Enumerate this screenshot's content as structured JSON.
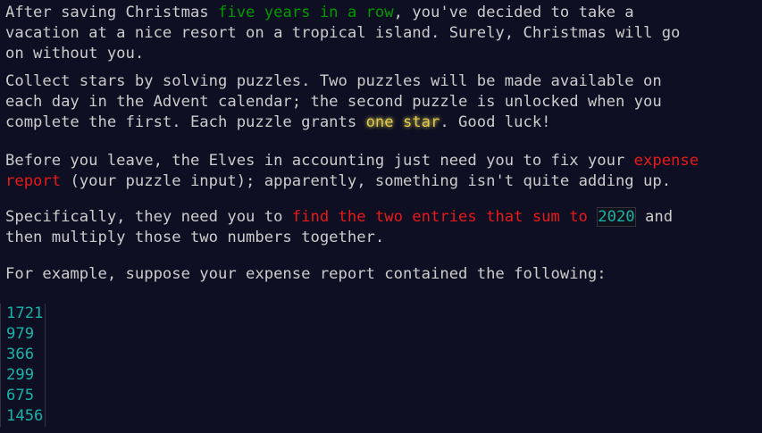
{
  "intro": {
    "p1_a": "After saving Christmas ",
    "p1_link": "five years in a row",
    "p1_b": ", you've decided to take a\nvacation at a nice resort on a tropical island. Surely, Christmas will go\non without you."
  },
  "rules": {
    "p2_a": "Collect stars by solving puzzles. Two puzzles will be made available on\neach day in the Advent calendar; the second puzzle is unlocked when you\ncomplete the first. Each puzzle grants ",
    "p2_star": "one star",
    "p2_b": ". Good luck!"
  },
  "task": {
    "p3_a": "Before you leave, the Elves in accounting just need you to fix your ",
    "p3_link": "expense\nreport",
    "p3_b": " (your puzzle input); apparently, something isn't quite adding up.",
    "p4_a": "Specifically, they need you to ",
    "p4_emph": "find the two entries that sum to ",
    "p4_code": "2020",
    "p4_b": " and\nthen multiply those two numbers together.",
    "p5": "For example, suppose your expense report contained the following:"
  },
  "example_entries": [
    "1721",
    "979",
    "366",
    "299",
    "675",
    "1456"
  ],
  "colors": {
    "background": "#0f0f23",
    "text": "#cccccc",
    "link_green": "#009900",
    "star_gold": "#e6c84a",
    "emphasis_red": "#e81919",
    "code_teal": "#17b3a8"
  }
}
